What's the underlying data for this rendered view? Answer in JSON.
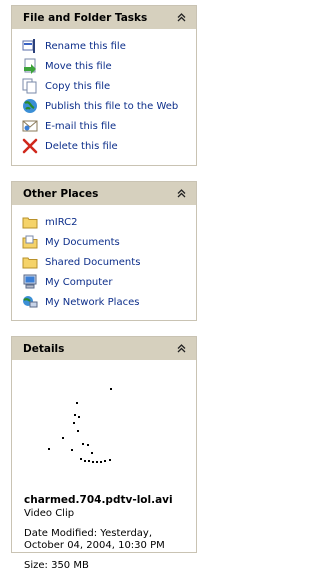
{
  "file_tasks": {
    "title": "File and Folder Tasks",
    "items": [
      {
        "label": "Rename this file",
        "icon": "rename-icon"
      },
      {
        "label": "Move this file",
        "icon": "move-icon"
      },
      {
        "label": "Copy this file",
        "icon": "copy-icon"
      },
      {
        "label": "Publish this file to the Web",
        "icon": "publish-web-icon"
      },
      {
        "label": "E-mail this file",
        "icon": "email-icon"
      },
      {
        "label": "Delete this file",
        "icon": "delete-icon"
      }
    ]
  },
  "other_places": {
    "title": "Other Places",
    "items": [
      {
        "label": "mIRC2",
        "icon": "folder-icon"
      },
      {
        "label": "My Documents",
        "icon": "my-documents-icon"
      },
      {
        "label": "Shared Documents",
        "icon": "folder-icon"
      },
      {
        "label": "My Computer",
        "icon": "my-computer-icon"
      },
      {
        "label": "My Network Places",
        "icon": "network-places-icon"
      }
    ]
  },
  "details": {
    "title": "Details",
    "filename": "charmed.704.pdtv-lol.avi",
    "type": "Video Clip",
    "modified_line1": "Date Modified: Yesterday,",
    "modified_line2": "October 04, 2004, 10:30 PM",
    "size": "Size: 350 MB"
  },
  "colors": {
    "header_bg": "#d6d0be",
    "link": "#0c2e8a"
  }
}
